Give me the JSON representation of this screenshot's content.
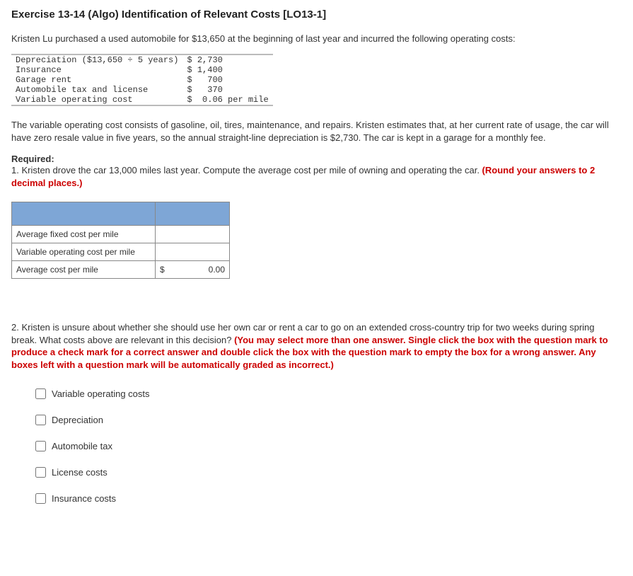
{
  "title": "Exercise 13-14 (Algo) Identification of Relevant Costs [LO13-1]",
  "intro": "Kristen Lu purchased a used automobile for $13,650 at the beginning of last year and incurred the following operating costs:",
  "costs": {
    "rows": [
      {
        "label": "Depreciation ($13,650 ÷ 5 years)",
        "amount": "$ 2,730"
      },
      {
        "label": "Insurance",
        "amount": "$ 1,400"
      },
      {
        "label": "Garage rent",
        "amount": "$   700"
      },
      {
        "label": "Automobile tax and license",
        "amount": "$   370"
      },
      {
        "label": "Variable operating cost",
        "amount": "$  0.06 per mile"
      }
    ]
  },
  "desc": "The variable operating cost consists of gasoline, oil, tires, maintenance, and repairs. Kristen estimates that, at her current rate of usage, the car will have zero resale value in five years, so the annual straight-line depreciation is $2,730. The car is kept in a garage for a monthly fee.",
  "required_head": "Required:",
  "q1_prefix": "1. Kristen drove the car 13,000 miles last year. Compute the average cost per mile of owning and operating the car. ",
  "q1_red": "(Round your answers to 2 decimal places.)",
  "answer": {
    "row1": "Average fixed cost per mile",
    "row2": "Variable operating cost per mile",
    "row3": "Average cost per mile",
    "dollar": "$",
    "total": "0.00"
  },
  "q2_prefix": "2. Kristen is unsure about whether she should use her own car or rent a car to go on an extended cross-country trip for two weeks during spring break. What costs above are relevant in this decision? ",
  "q2_bold": "(You may select more than one answer. Single click the box with the question mark to produce a check mark for a correct answer and double click the box with the question mark to empty the box for a wrong answer. Any boxes left with a question mark will be automatically graded as incorrect.)",
  "options": {
    "o1": "Variable operating costs",
    "o2": "Depreciation",
    "o3": "Automobile tax",
    "o4": "License costs",
    "o5": "Insurance costs"
  }
}
